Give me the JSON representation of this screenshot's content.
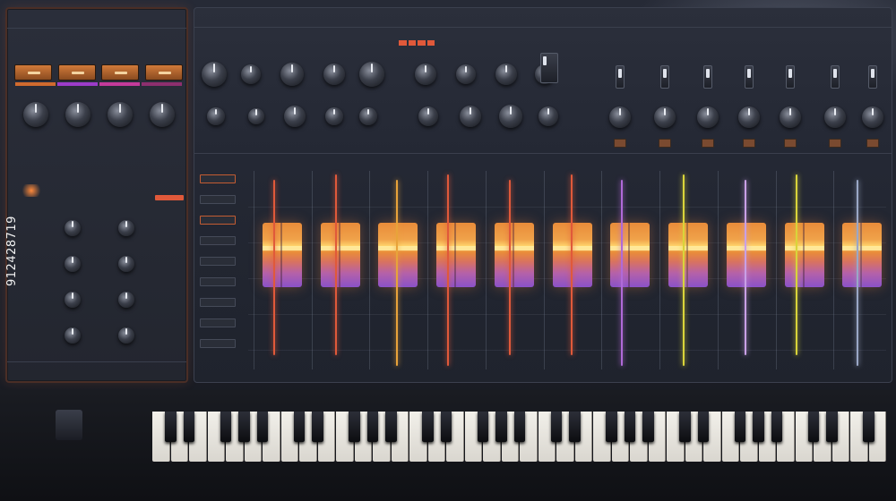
{
  "left_rack": {
    "header": [
      "",
      "",
      "",
      ""
    ],
    "labels": [
      "",
      "",
      "",
      ""
    ],
    "footer_left": "",
    "footer_right": "",
    "stripe_colors": [
      "#d06a2e",
      "#9c3cc9",
      "#c43a9a",
      "#8d2f6e"
    ]
  },
  "main_panel": {
    "topbar": [
      "",
      "",
      "",
      ""
    ],
    "topbar_right": "",
    "channel_titles": [
      "",
      "",
      "",
      "",
      "",
      "",
      "",
      ""
    ],
    "accent_color": "#e0593a"
  },
  "tracks": [
    {
      "line_color": "#e0593a"
    },
    {
      "line_color": "#e0593a"
    },
    {
      "line_color": "#e8a33a"
    },
    {
      "line_color": "#e0593a"
    },
    {
      "line_color": "#e0593a"
    },
    {
      "line_color": "#e0593a"
    },
    {
      "line_color": "#b06ad8"
    },
    {
      "line_color": "#d9d43a"
    },
    {
      "line_color": "#c9a0e6"
    },
    {
      "line_color": "#d9d43a"
    },
    {
      "line_color": "#9aa7c6"
    }
  ],
  "watermark_id": "912428719"
}
